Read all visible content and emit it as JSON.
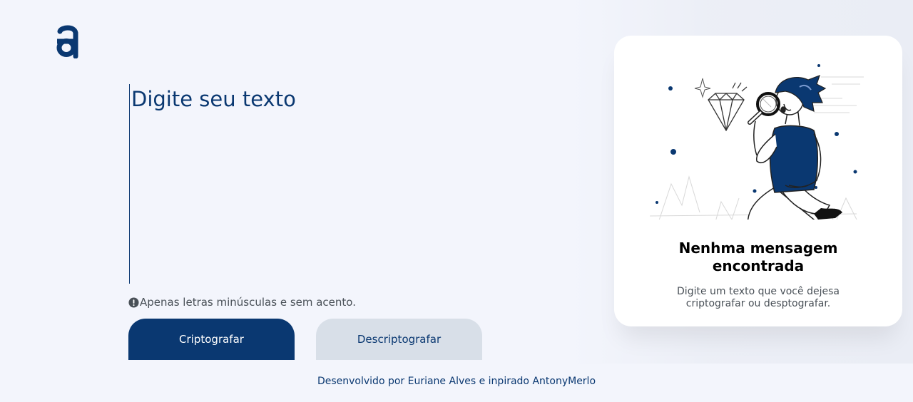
{
  "input": {
    "placeholder": "Digite seu texto"
  },
  "hint": {
    "icon": "exclamation-circle-icon",
    "text": "Apenas letras minúsculas e sem acento."
  },
  "buttons": {
    "encrypt_label": "Criptografar",
    "decrypt_label": "Descriptografar"
  },
  "output": {
    "title_line1": "Nenhma mensagem",
    "title_line2": "encontrada",
    "desc_line1": "Digite um texto que você dejesa",
    "desc_line2": "criptografar ou desptografar."
  },
  "footer": {
    "text": "Desenvolvido por Euriane Alves e inpirado AntonyMerlo"
  },
  "colors": {
    "primary": "#0A3871",
    "secondary_button": "#D8DFE8",
    "background": "#F3F5FC",
    "card": "#FFFFFF"
  }
}
